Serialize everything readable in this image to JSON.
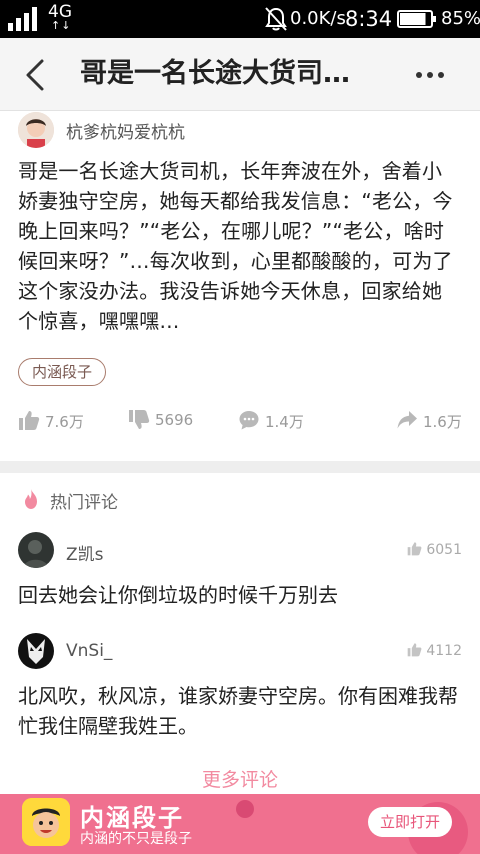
{
  "status_bar": {
    "network": "4G",
    "net_arrows": "↑↓",
    "speed": "0.0K/s",
    "time": "8:34",
    "battery": "85%",
    "battery_level": 0.85,
    "icons": [
      "signal-icon",
      "bell-off-icon",
      "battery-icon"
    ]
  },
  "nav": {
    "title": "哥是一名长途大货司…",
    "icons": [
      "back-arrow-icon",
      "more-dots-icon"
    ]
  },
  "post": {
    "author": "杭爹杭妈爱杭杭",
    "text": "哥是一名长途大货司机，长年奔波在外，舍着小娇妻独守空房，她每天都给我发信息：“老公，今晚上回来吗？”“老公，在哪儿呢？”“老公，啥时候回来呀？”…每次收到，心里都酸酸的，可为了这个家没办法。我没告诉她今天休息，回家给她个惊喜，嘿嘿嘿…",
    "tag": "内涵段子",
    "actions": {
      "like": "7.6万",
      "dislike": "5696",
      "comment": "1.4万",
      "share": "1.6万"
    }
  },
  "comments": {
    "section_title": "热门评论",
    "items": [
      {
        "user": "Z凯s",
        "likes": "6051",
        "text": "回去她会让你倒垃圾的时候千万别去"
      },
      {
        "user": "VnSi_",
        "likes": "4112",
        "text": "北风吹，秋风凉，谁家娇妻守空房。你有困难我帮忙我住隔壁我姓王。"
      }
    ],
    "more_label": "更多评论"
  },
  "banner": {
    "brand": "内涵段子",
    "slogan": "内涵的不只是段子",
    "button": "立即打开"
  },
  "colors": {
    "accent_pink": "#f28aa0",
    "banner_bg": "#f0708f",
    "tag_border": "#a97c6d"
  }
}
